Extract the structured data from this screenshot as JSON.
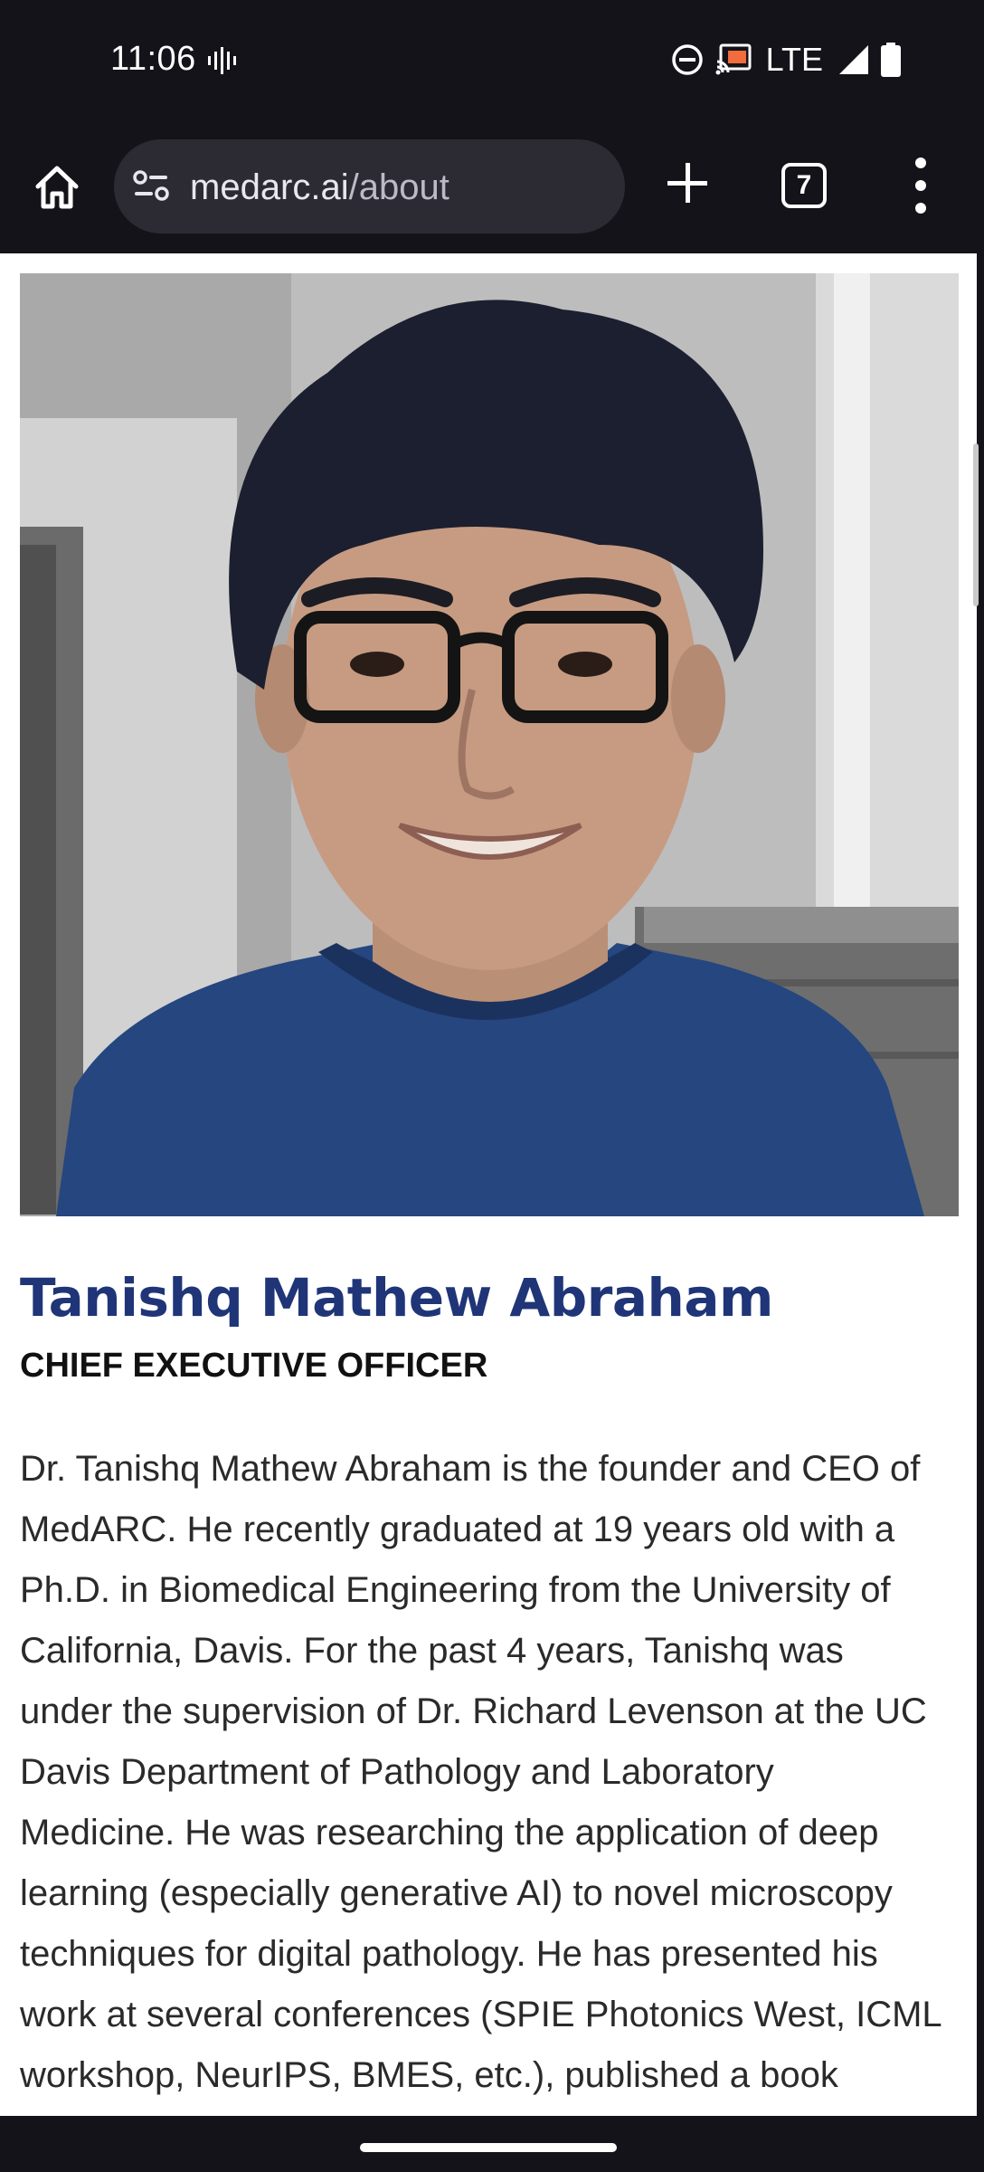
{
  "status_bar": {
    "time": "11:06",
    "network": "LTE",
    "icons": [
      "vibrate-icon",
      "do-not-disturb-icon",
      "cast-icon",
      "signal-icon",
      "battery-icon"
    ]
  },
  "browser": {
    "url_domain": "medarc.ai",
    "url_path": "/about",
    "tab_count": "7",
    "icons": [
      "home-icon",
      "site-info-icon",
      "new-tab-icon",
      "tab-switcher-icon",
      "more-options-icon"
    ]
  },
  "profile": {
    "photo_alt": "Portrait photo",
    "name": "Tanishq Mathew Abraham",
    "role": "CHIEF EXECUTIVE OFFICER",
    "bio_lines": [
      "Dr. Tanishq Mathew Abraham is the founder and CEO of",
      "MedARC. He recently graduated at 19 years old with a",
      "Ph.D. in Biomedical Engineering from the University of",
      "California, Davis. For the past 4 years, Tanishq was",
      "under the supervision of Dr. Richard Levenson at the UC",
      "Davis Department of Pathology and Laboratory",
      "Medicine. He was researching the application of deep",
      "learning (especially generative AI) to novel microscopy",
      "techniques for digital pathology. He has presented his",
      "work at several conferences (SPIE Photonics West, ICML",
      "workshop, NeurIPS, BMES, etc.), published a book"
    ]
  },
  "colors": {
    "name": "#1f3578",
    "chrome": "#14131a",
    "url_bar": "#2c2b33"
  }
}
